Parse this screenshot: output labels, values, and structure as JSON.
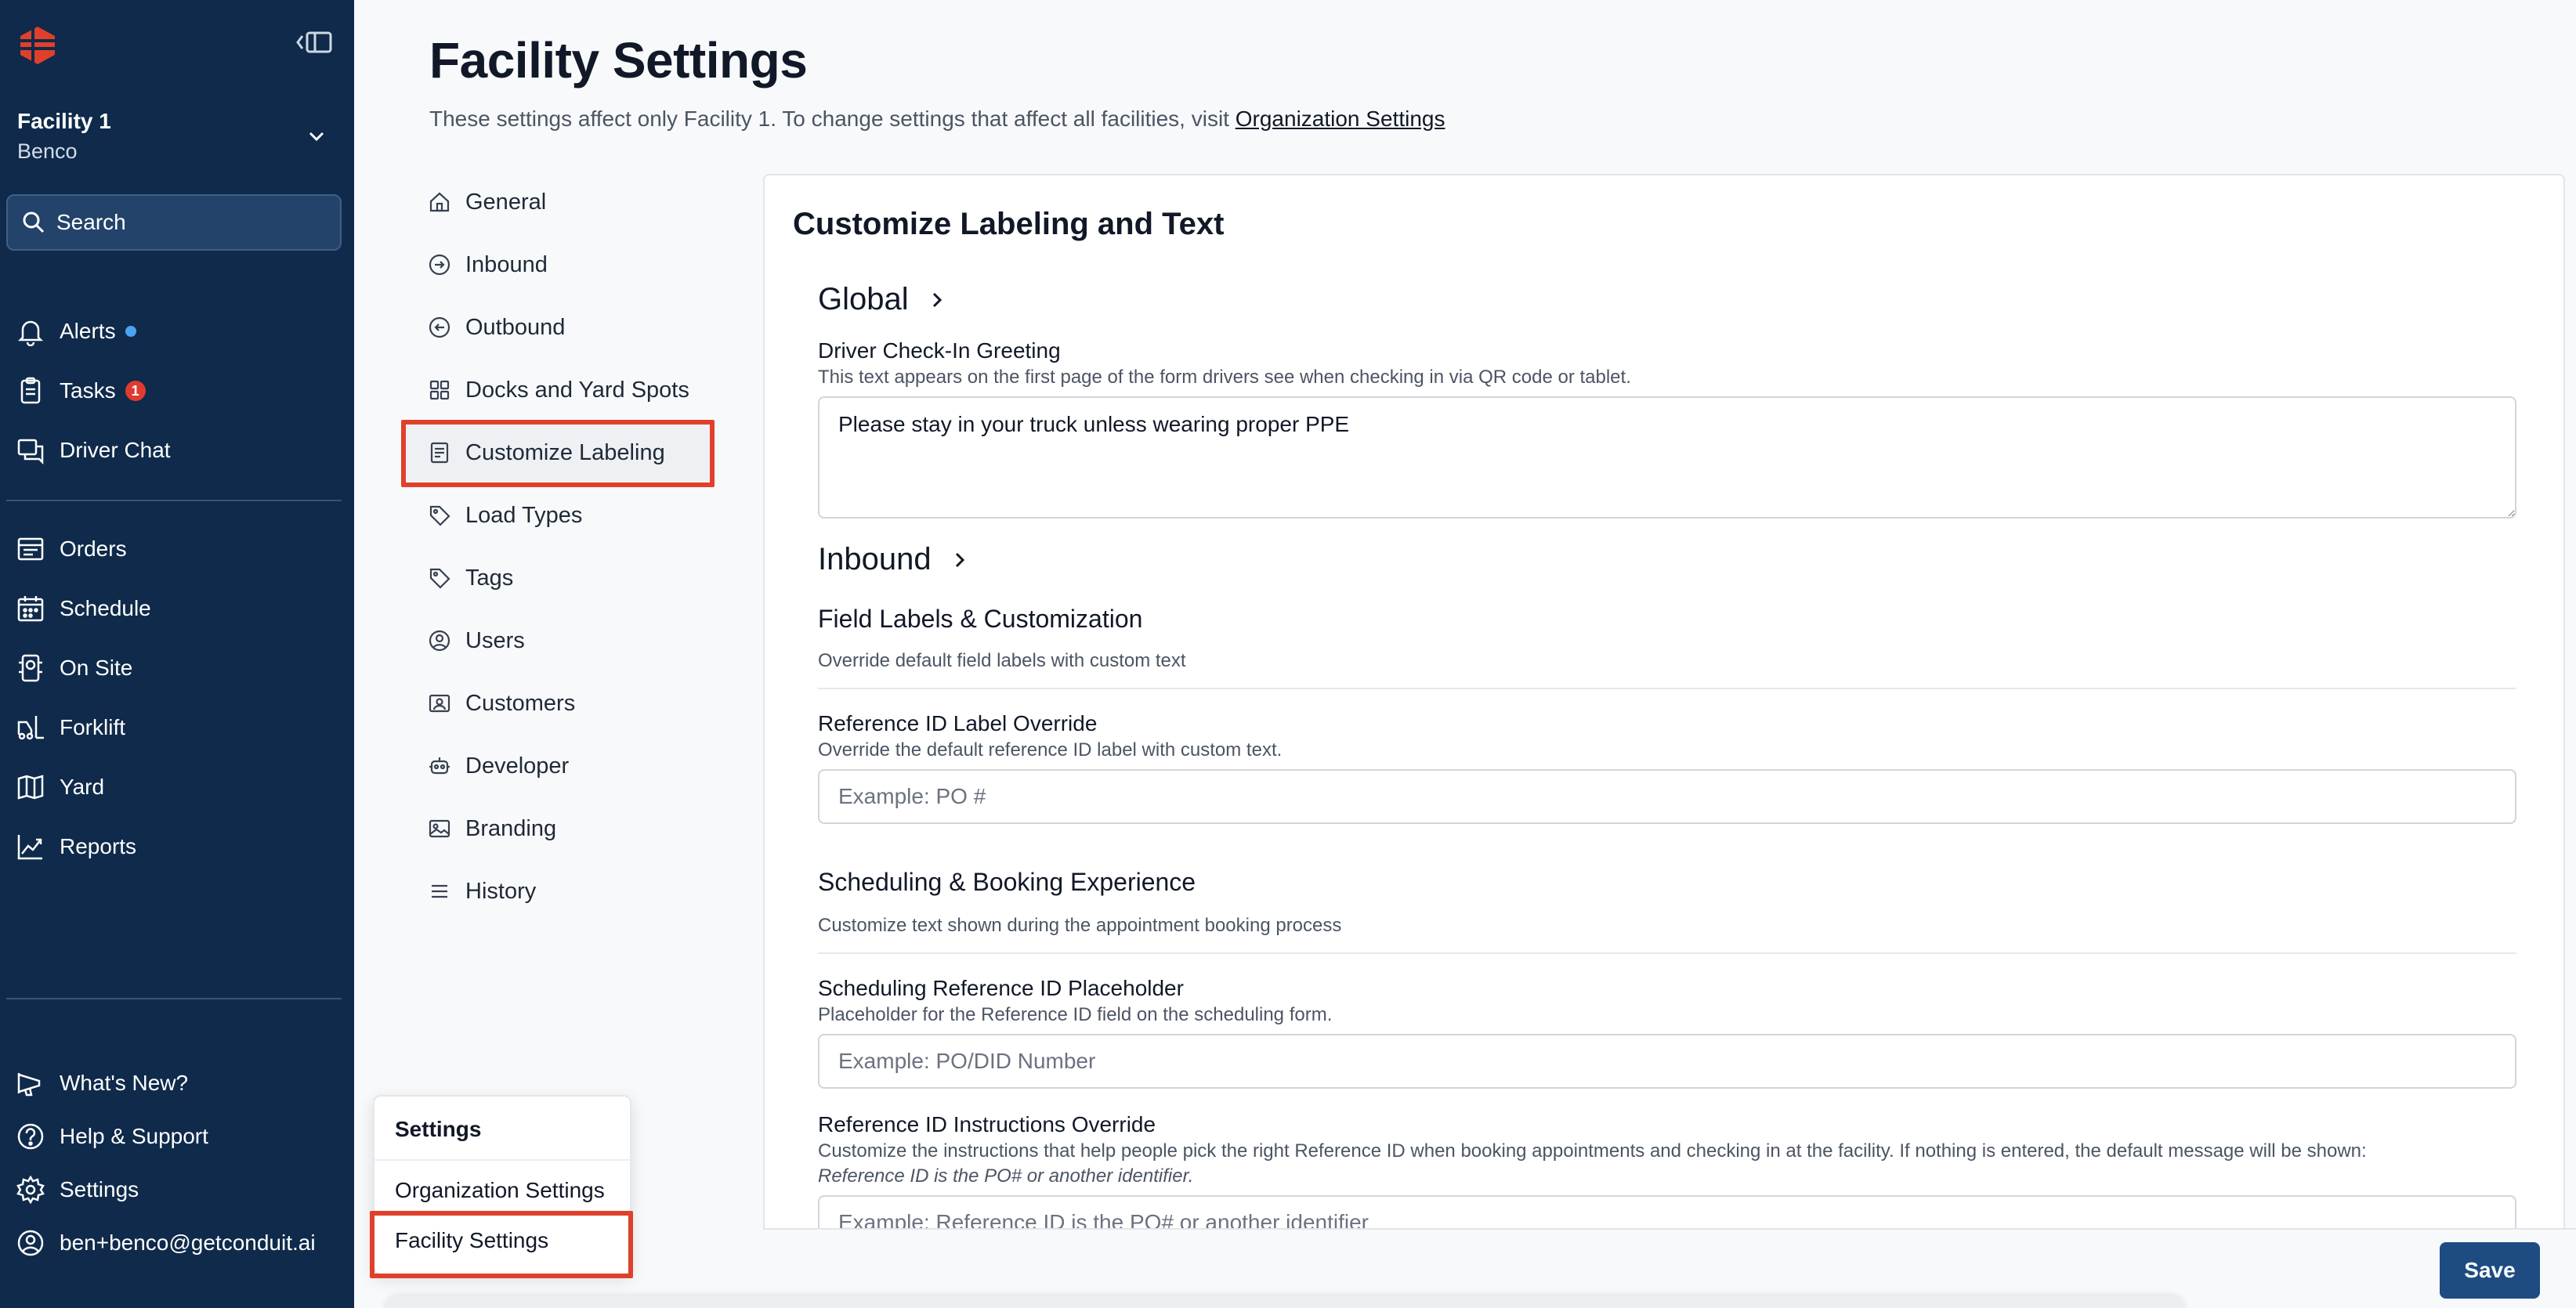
{
  "sidebar": {
    "facility_name": "Facility 1",
    "facility_org": "Benco",
    "search_label": "Search",
    "nav_main": [
      {
        "label": "Alerts",
        "icon": "bell-icon"
      },
      {
        "label": "Tasks",
        "icon": "clipboard-icon",
        "badge": "1"
      },
      {
        "label": "Driver Chat",
        "icon": "chat-icon"
      }
    ],
    "nav_ops": [
      {
        "label": "Orders",
        "icon": "orders-icon"
      },
      {
        "label": "Schedule",
        "icon": "calendar-icon"
      },
      {
        "label": "On Site",
        "icon": "onsite-icon"
      },
      {
        "label": "Forklift",
        "icon": "forklift-icon"
      },
      {
        "label": "Yard",
        "icon": "map-icon"
      },
      {
        "label": "Reports",
        "icon": "chart-line-icon"
      }
    ],
    "nav_bottom": [
      {
        "label": "What's New?",
        "icon": "megaphone-icon"
      },
      {
        "label": "Help & Support",
        "icon": "help-icon"
      },
      {
        "label": "Settings",
        "icon": "gear-icon"
      },
      {
        "label": "ben+benco@getconduit.ai",
        "icon": "user-circle-icon"
      }
    ]
  },
  "header": {
    "title": "Facility Settings",
    "description": "These settings affect only Facility 1. To change settings that affect all facilities, visit",
    "org_link": "Organization Settings"
  },
  "settings_nav": [
    {
      "label": "General",
      "icon": "home-icon"
    },
    {
      "label": "Inbound",
      "icon": "arrow-in-icon"
    },
    {
      "label": "Outbound",
      "icon": "arrow-out-icon"
    },
    {
      "label": "Docks and Yard Spots",
      "icon": "grid-icon"
    },
    {
      "label": "Customize Labeling",
      "icon": "document-icon",
      "active": true
    },
    {
      "label": "Load Types",
      "icon": "tag-icon"
    },
    {
      "label": "Tags",
      "icon": "tag-icon"
    },
    {
      "label": "Users",
      "icon": "user-icon"
    },
    {
      "label": "Customers",
      "icon": "contact-icon"
    },
    {
      "label": "Developer",
      "icon": "robot-icon"
    },
    {
      "label": "Branding",
      "icon": "image-icon"
    },
    {
      "label": "History",
      "icon": "list-icon"
    }
  ],
  "content": {
    "card_title": "Customize Labeling and Text",
    "global_heading": "Global",
    "greeting_label": "Driver Check-In Greeting",
    "greeting_help": "This text appears on the first page of the form drivers see when checking in via QR code or tablet.",
    "greeting_value": "Please stay in your truck unless wearing proper PPE",
    "inbound_heading": "Inbound",
    "field_labels_heading": "Field Labels & Customization",
    "field_labels_help": "Override default field labels with custom text",
    "ref_label": "Reference ID Label Override",
    "ref_help": "Override the default reference ID label with custom text.",
    "ref_placeholder": "Example: PO #",
    "scheduling_heading": "Scheduling & Booking Experience",
    "scheduling_help": "Customize text shown during the appointment booking process",
    "sched_ref_label": "Scheduling Reference ID Placeholder",
    "sched_ref_help": "Placeholder for the Reference ID field on the scheduling form.",
    "sched_ref_placeholder": "Example: PO/DID Number",
    "ref_instr_label": "Reference ID Instructions Override",
    "ref_instr_help": "Customize the instructions that help people pick the right Reference ID when booking appointments and checking in at the facility. If nothing is entered, the default message will be shown:",
    "ref_instr_default": "Reference ID is the PO# or another identifier.",
    "ref_instr_placeholder": "Example: Reference ID is the PO# or another identifier"
  },
  "footer": {
    "save_label": "Save"
  },
  "popover": {
    "title": "Settings",
    "items": [
      "Organization Settings",
      "Facility Settings"
    ]
  },
  "colors": {
    "sidebar_bg": "#0f2a4a",
    "accent": "#1e4c82",
    "highlight": "#e0402b",
    "badge": "#e03b2e",
    "alert_dot": "#4aa3f0"
  }
}
